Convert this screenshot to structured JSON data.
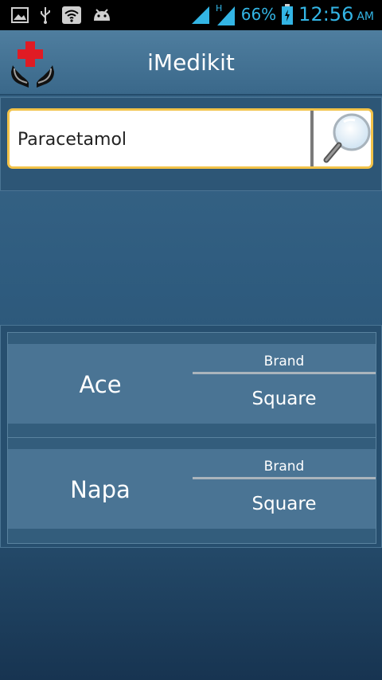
{
  "status_bar": {
    "battery_percent": "66%",
    "time": "12:56",
    "ampm": "AM",
    "network_type": "H",
    "icons": [
      "image-icon",
      "usb-icon",
      "wifi-icon",
      "android-icon",
      "signal-icon",
      "signal-h-icon",
      "battery-charging-icon"
    ]
  },
  "app_bar": {
    "title": "iMedikit",
    "logo_icon": "medical-hands-cross-icon"
  },
  "search": {
    "value": "Paracetamol",
    "button_icon": "magnifier-icon"
  },
  "results": [
    {
      "name": "Ace",
      "brand_label": "Brand",
      "brand_value": "Square"
    },
    {
      "name": "Napa",
      "brand_label": "Brand",
      "brand_value": "Square"
    }
  ],
  "colors": {
    "accent_blue": "#33b5e5",
    "search_border": "#f2c249",
    "logo_cross": "#e01b24"
  }
}
